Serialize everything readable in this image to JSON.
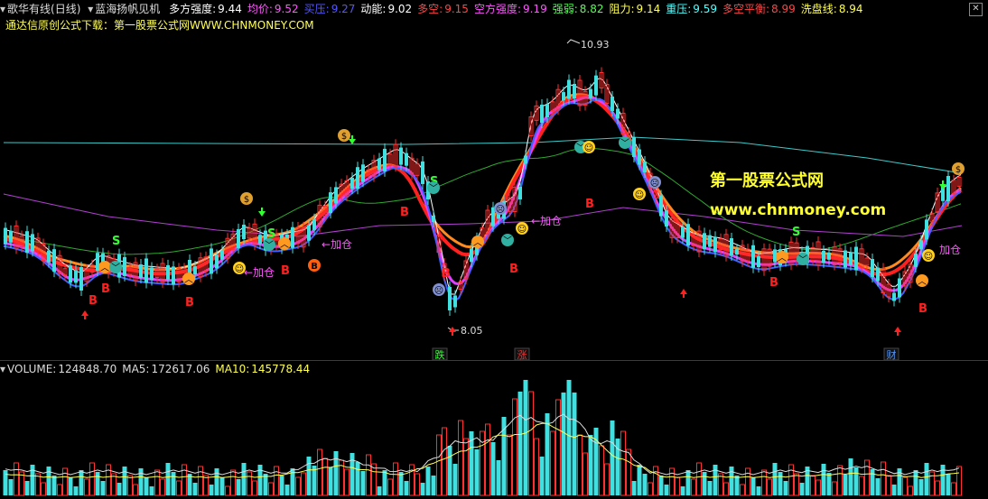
{
  "header": {
    "app_title": "歌华有线(日线)",
    "indicator_name": "蓝海扬帆见机",
    "items": [
      {
        "label": "多方强度:",
        "value": "9.44",
        "color": "#ffffff"
      },
      {
        "label": "均价:",
        "value": "9.52",
        "color": "#ff55ff"
      },
      {
        "label": "买压:",
        "value": "9.27",
        "color": "#5555ff"
      },
      {
        "label": "动能:",
        "value": "9.02",
        "color": "#ffffff"
      },
      {
        "label": "多空:",
        "value": "9.15",
        "color": "#ff4444"
      },
      {
        "label": "空方强度:",
        "value": "9.19",
        "color": "#ff55ff"
      },
      {
        "label": "强弱:",
        "value": "8.82",
        "color": "#55ff55"
      },
      {
        "label": "阻力:",
        "value": "9.14",
        "color": "#ffff55"
      },
      {
        "label": "重压:",
        "value": "9.59",
        "color": "#55ffff"
      },
      {
        "label": "多空平衡:",
        "value": "8.99",
        "color": "#ff4444"
      },
      {
        "label": "洗盘线:",
        "value": "8.94",
        "color": "#ffff55"
      }
    ],
    "subline": "通达信原创公式下载：第一股票公式网WWW.CHNMONEY.COM",
    "close_icon": "close-icon"
  },
  "price_chart": {
    "high_label": "10.93",
    "low_label": "8.05",
    "watermark_title": "第一股票公式网",
    "watermark_url": "www.chnmoney.com",
    "annotations": {
      "add_position": "←加仓",
      "add_position_2": "加仓",
      "buy": "B",
      "sell": "S",
      "bottom_tags": [
        "跌",
        "涨",
        "财"
      ]
    }
  },
  "volume_panel": {
    "label": "VOLUME:",
    "volume": "124848.70",
    "ma5_label": "MA5:",
    "ma5": "172617.06",
    "ma10_label": "MA10:",
    "ma10": "145778.44"
  }
}
